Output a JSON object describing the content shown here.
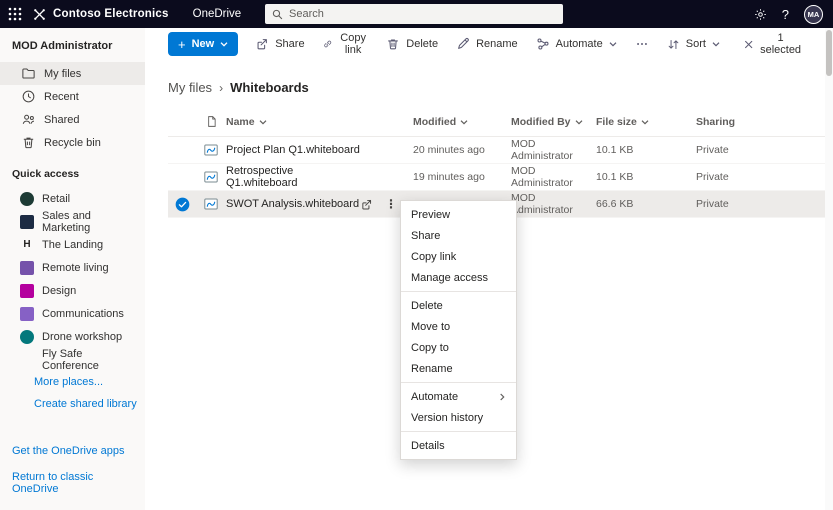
{
  "topbar": {
    "brand": "Contoso Electronics",
    "app_name": "OneDrive",
    "search_placeholder": "Search",
    "help_label": "?",
    "avatar_initials": "MA"
  },
  "sidebar": {
    "user_name": "MOD Administrator",
    "nav_items": [
      {
        "label": "My files",
        "selected": true
      },
      {
        "label": "Recent"
      },
      {
        "label": "Shared"
      },
      {
        "label": "Recycle bin"
      }
    ],
    "quick_access_label": "Quick access",
    "quick_access_items": [
      {
        "label": "Retail",
        "color": "#1d3b35",
        "is_circle": true
      },
      {
        "label": "Sales and Marketing",
        "color": "#1c2b43"
      },
      {
        "label": "The Landing",
        "glyph": "H",
        "glyph_color": "#252423"
      },
      {
        "label": "Remote living",
        "color": "#7552aa"
      },
      {
        "label": "Design",
        "color": "#b4009e"
      },
      {
        "label": "Communications",
        "color": "#8661c5"
      },
      {
        "label": "Drone workshop",
        "color": "#03787c",
        "is_circle": true
      },
      {
        "label": "Fly Safe Conference",
        "no_icon": true
      }
    ],
    "links": [
      {
        "label": "More places..."
      },
      {
        "label": "Create shared library"
      }
    ],
    "footer_links": [
      {
        "label": "Get the OneDrive apps"
      },
      {
        "label": "Return to classic OneDrive"
      }
    ]
  },
  "toolbar": {
    "new_label": "New",
    "commands": [
      {
        "label": "Share"
      },
      {
        "label": "Copy link"
      },
      {
        "label": "Delete"
      },
      {
        "label": "Rename"
      },
      {
        "label": "Automate"
      }
    ],
    "sort_label": "Sort",
    "selection_label": "1 selected",
    "accent_color": "#0078d4"
  },
  "breadcrumb": {
    "parent": "My files",
    "current": "Whiteboards"
  },
  "table": {
    "columns": [
      "Name",
      "Modified",
      "Modified By",
      "File size",
      "Sharing"
    ],
    "rows": [
      {
        "name": "Project Plan Q1.whiteboard",
        "modified": "20 minutes ago",
        "modified_by": "MOD Administrator",
        "file_size": "10.1 KB",
        "sharing": "Private"
      },
      {
        "name": "Retrospective Q1.whiteboard",
        "modified": "19 minutes ago",
        "modified_by": "MOD Administrator",
        "file_size": "10.1 KB",
        "sharing": "Private"
      },
      {
        "name": "SWOT Analysis.whiteboard",
        "modified": "",
        "modified_by": "MOD Administrator",
        "file_size": "66.6 KB",
        "sharing": "Private",
        "selected": true
      }
    ]
  },
  "context_menu": {
    "items": [
      {
        "label": "Preview"
      },
      {
        "label": "Share"
      },
      {
        "label": "Copy link"
      },
      {
        "label": "Manage access",
        "divider_after": true
      },
      {
        "label": "Delete"
      },
      {
        "label": "Move to"
      },
      {
        "label": "Copy to"
      },
      {
        "label": "Rename",
        "divider_after": true
      },
      {
        "label": "Automate",
        "submenu": true
      },
      {
        "label": "Version history",
        "divider_after": true
      },
      {
        "label": "Details"
      }
    ]
  }
}
